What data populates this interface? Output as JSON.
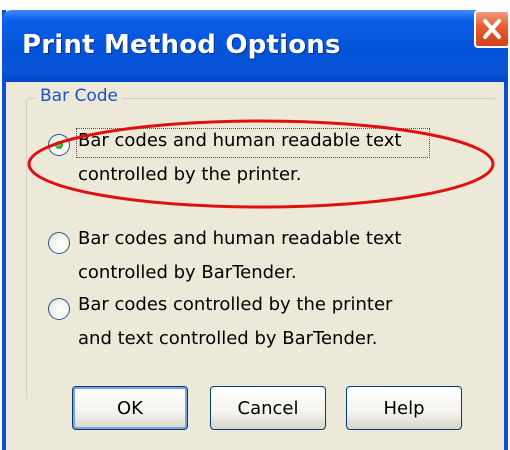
{
  "window": {
    "title": "Print Method Options"
  },
  "group": {
    "label": "Bar Code"
  },
  "options": [
    {
      "line1": "Bar codes and human readable text",
      "line2": "controlled by the printer.",
      "selected": true
    },
    {
      "line1": "Bar codes and human readable text",
      "line2": "controlled by BarTender.",
      "selected": false
    },
    {
      "line1": "Bar codes controlled by the printer",
      "line2": "and text controlled by BarTender.",
      "selected": false
    }
  ],
  "buttons": {
    "ok": "OK",
    "cancel": "Cancel",
    "help": "Help"
  },
  "colors": {
    "title_bar": "#0453d7",
    "close_button": "#e55b30",
    "dialog_face": "#ece9d8",
    "group_label": "#1e50c8",
    "annotation_ellipse": "#e01010",
    "radio_selected_dot": "#2da52a"
  },
  "icons": {
    "close": "close-x-icon"
  }
}
